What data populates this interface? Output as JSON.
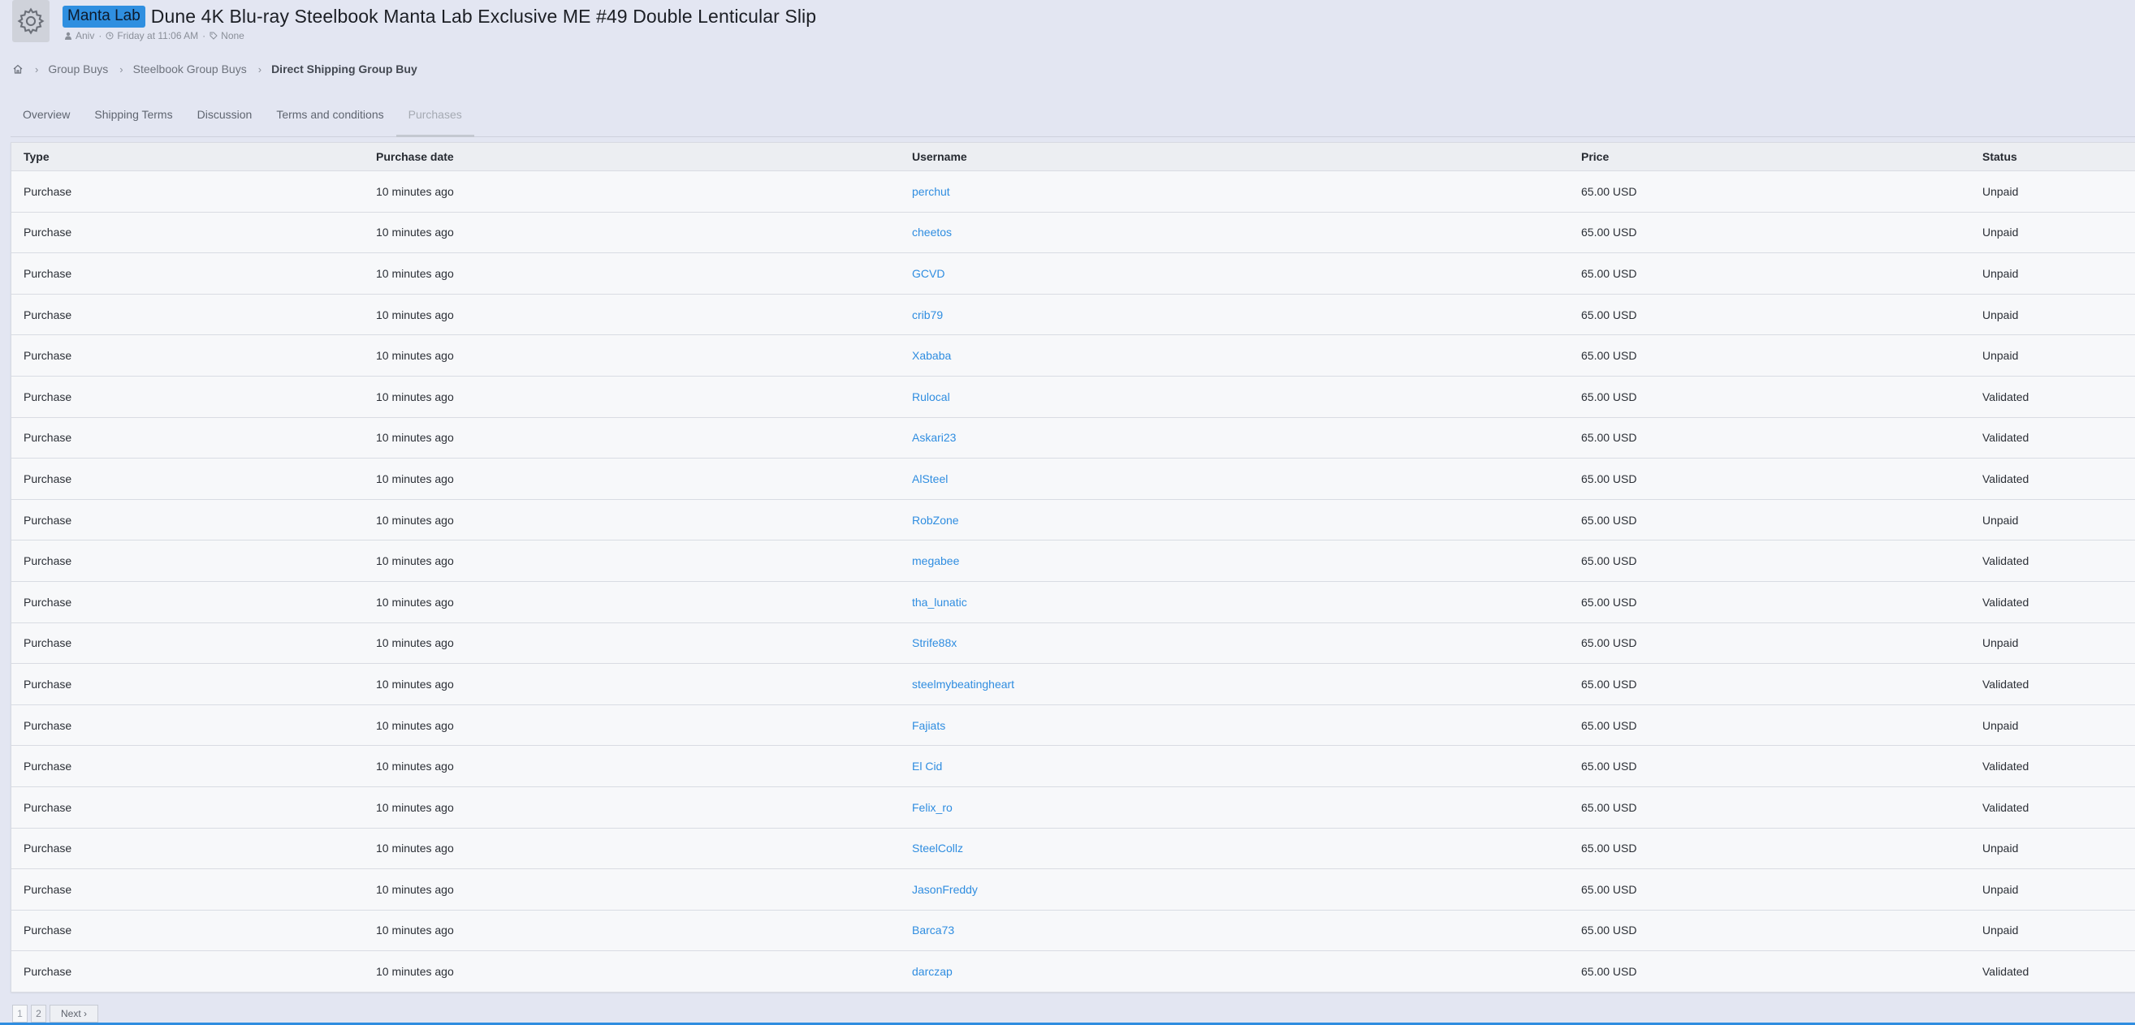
{
  "header": {
    "prefix": "Manta Lab",
    "title": "Dune 4K Blu-ray Steelbook Manta Lab Exclusive ME #49 Double Lenticular Slip",
    "author": "Aniv",
    "date": "Friday at 11:06 AM",
    "tags": "None",
    "avatar_icon": "gear-icon"
  },
  "breadcrumb": {
    "home_icon": "home-icon",
    "items": [
      "Group Buys",
      "Steelbook Group Buys"
    ],
    "current": "Direct Shipping Group Buy"
  },
  "tabs": [
    {
      "label": "Overview"
    },
    {
      "label": "Shipping Terms"
    },
    {
      "label": "Discussion"
    },
    {
      "label": "Terms and conditions"
    },
    {
      "label": "Purchases",
      "active": true
    }
  ],
  "table": {
    "columns": [
      "Type",
      "Purchase date",
      "Username",
      "Price",
      "Status"
    ],
    "rows": [
      {
        "type": "Purchase",
        "date": "10 minutes ago",
        "username": "perchut",
        "price": "65.00 USD",
        "status": "Unpaid"
      },
      {
        "type": "Purchase",
        "date": "10 minutes ago",
        "username": "cheetos",
        "price": "65.00 USD",
        "status": "Unpaid"
      },
      {
        "type": "Purchase",
        "date": "10 minutes ago",
        "username": "GCVD",
        "price": "65.00 USD",
        "status": "Unpaid"
      },
      {
        "type": "Purchase",
        "date": "10 minutes ago",
        "username": "crib79",
        "price": "65.00 USD",
        "status": "Unpaid"
      },
      {
        "type": "Purchase",
        "date": "10 minutes ago",
        "username": "Xababa",
        "price": "65.00 USD",
        "status": "Unpaid"
      },
      {
        "type": "Purchase",
        "date": "10 minutes ago",
        "username": "Rulocal",
        "price": "65.00 USD",
        "status": "Validated"
      },
      {
        "type": "Purchase",
        "date": "10 minutes ago",
        "username": "Askari23",
        "price": "65.00 USD",
        "status": "Validated"
      },
      {
        "type": "Purchase",
        "date": "10 minutes ago",
        "username": "AlSteel",
        "price": "65.00 USD",
        "status": "Validated"
      },
      {
        "type": "Purchase",
        "date": "10 minutes ago",
        "username": "RobZone",
        "price": "65.00 USD",
        "status": "Unpaid"
      },
      {
        "type": "Purchase",
        "date": "10 minutes ago",
        "username": "megabee",
        "price": "65.00 USD",
        "status": "Validated"
      },
      {
        "type": "Purchase",
        "date": "10 minutes ago",
        "username": "tha_lunatic",
        "price": "65.00 USD",
        "status": "Validated"
      },
      {
        "type": "Purchase",
        "date": "10 minutes ago",
        "username": "Strife88x",
        "price": "65.00 USD",
        "status": "Unpaid"
      },
      {
        "type": "Purchase",
        "date": "10 minutes ago",
        "username": "steelmybeatingheart",
        "price": "65.00 USD",
        "status": "Validated"
      },
      {
        "type": "Purchase",
        "date": "10 minutes ago",
        "username": "Fajiats",
        "price": "65.00 USD",
        "status": "Unpaid"
      },
      {
        "type": "Purchase",
        "date": "10 minutes ago",
        "username": "El Cid",
        "price": "65.00 USD",
        "status": "Validated"
      },
      {
        "type": "Purchase",
        "date": "10 minutes ago",
        "username": "Felix_ro",
        "price": "65.00 USD",
        "status": "Validated"
      },
      {
        "type": "Purchase",
        "date": "10 minutes ago",
        "username": "SteelCollz",
        "price": "65.00 USD",
        "status": "Unpaid"
      },
      {
        "type": "Purchase",
        "date": "10 minutes ago",
        "username": "JasonFreddy",
        "price": "65.00 USD",
        "status": "Unpaid"
      },
      {
        "type": "Purchase",
        "date": "10 minutes ago",
        "username": "Barca73",
        "price": "65.00 USD",
        "status": "Unpaid"
      },
      {
        "type": "Purchase",
        "date": "10 minutes ago",
        "username": "darczap",
        "price": "65.00 USD",
        "status": "Validated"
      }
    ]
  },
  "pagination": {
    "pages": [
      "1",
      "2"
    ],
    "current": "1",
    "next_label": "Next ›"
  },
  "colors": {
    "background": "#e3e6f2",
    "accent": "#2f8de0",
    "prefix_bg": "#2f8fe0"
  }
}
